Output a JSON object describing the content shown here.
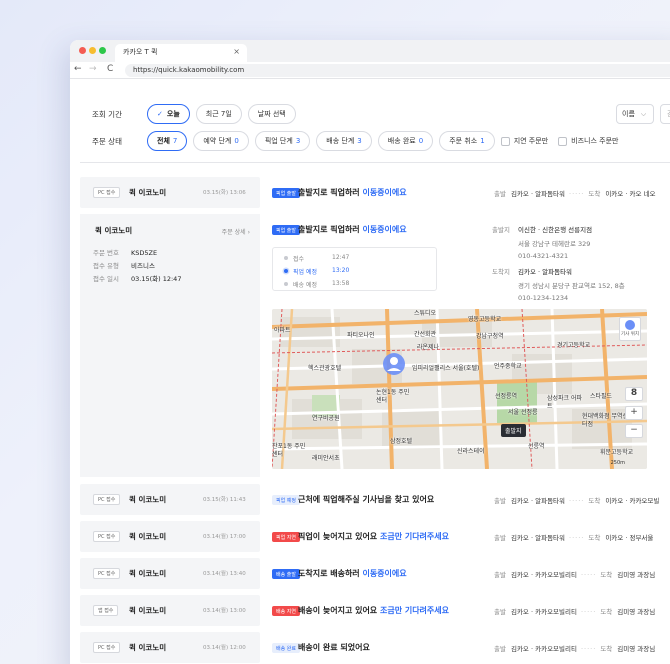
{
  "browser": {
    "tab_title": "카카오 T 퀵",
    "tab_close": "×",
    "url": "https://quick.kakaomobility.com",
    "back": "←",
    "forward": "→",
    "reload": "C"
  },
  "filters": {
    "period_label": "조회 기간",
    "period_options": [
      "오늘",
      "최근 7일",
      "날짜 선택"
    ],
    "period_check": "✓",
    "status_label": "주문 상태",
    "status_options": [
      {
        "label": "전체",
        "count": "7"
      },
      {
        "label": "예약 단계",
        "count": "0"
      },
      {
        "label": "픽업 단계",
        "count": "3"
      },
      {
        "label": "배송 단계",
        "count": "3"
      },
      {
        "label": "배송 완료",
        "count": "0"
      },
      {
        "label": "주문 취소",
        "count": "1"
      }
    ],
    "checkbox_delay": "지연 주문만",
    "checkbox_business": "비즈니스 주문만",
    "sort_value": "이름",
    "sort_caret": "⌵",
    "search_placeholder": "검색어를"
  },
  "labels": {
    "pickup": "출발",
    "dropoff": "도착",
    "dots": "·····",
    "detail": "주문 상세",
    "detail_arrow": "›"
  },
  "orders": [
    {
      "channel": "PC 접수",
      "service": "퀵 이코노미",
      "date": "03.15(화) 13:06",
      "badge": "픽업 출발",
      "msg_a": "출발지로 픽업하러 ",
      "msg_hl": "이동중이에요",
      "from": "김카오 · 알파돔타워",
      "to": "이카오 · 카오 네오"
    },
    {
      "channel": "PC 접수",
      "service": "퀵 이코노미",
      "date": "03.15(화) 11:43",
      "badge": "픽업 예정",
      "msg_a": "근처에 픽업해주실 기사님을 찾고 있어요",
      "msg_hl": "",
      "from": "김카오 · 알파돔타워",
      "to": "이카오 · 카카오모빌"
    },
    {
      "channel": "PC 접수",
      "service": "퀵 이코노미",
      "date": "03.14(월) 17:00",
      "badge": "픽업 지연",
      "msg_a": "픽업이 늦어지고 있어요 ",
      "msg_hl": "조금만 기다려주세요",
      "from": "김카오 · 알파돔타워",
      "to": "이카오 · 정부서울"
    },
    {
      "channel": "PC 접수",
      "service": "퀵 이코노미",
      "date": "03.14(월) 13:40",
      "badge": "배송 출발",
      "msg_a": "도착지로 배송하러 ",
      "msg_hl": "이동중이에요",
      "from": "김카오 · 카카오모빌리티",
      "to": "김미영 과장님"
    },
    {
      "channel": "앱 접수",
      "service": "퀵 이코노미",
      "date": "03.14(월) 13:00",
      "badge": "배송 지연",
      "msg_a": "배송이 늦어지고 있어요 ",
      "msg_hl": "조금만 기다려주세요",
      "from": "김카오 · 카카오모빌리티",
      "to": "김미영 과장님"
    },
    {
      "channel": "PC 접수",
      "service": "퀵 이코노미",
      "date": "03.14(월) 12:00",
      "badge": "배송 완료",
      "msg_a": "배송이 완료 되었어요",
      "msg_hl": "",
      "from": "김카오 · 카카오모빌리티",
      "to": "김미영 과장님"
    }
  ],
  "expanded": {
    "service": "퀵 이코노미",
    "badge": "픽업 출발",
    "msg_a": "출발지로 픽업하러 ",
    "msg_hl": "이동중이에요",
    "order_no_k": "주문 번호",
    "order_no_v": "KSD5ZE",
    "type_k": "접수 유형",
    "type_v": "비즈니스",
    "time_k": "접수 일시",
    "time_v": "03.15(화) 12:47",
    "timeline": [
      {
        "label": "접수",
        "time": "12:47"
      },
      {
        "label": "픽업 예정",
        "time": "13:20"
      },
      {
        "label": "배송 예정",
        "time": "13:58"
      }
    ],
    "sender_k": "출발지",
    "sender_v": "이신한 · 신한은행 선릉지점",
    "sender_addr": "서울 강남구 테헤란로 329",
    "sender_tel": "010-4321-4321",
    "recv_k": "도착지",
    "recv_v": "김카오 · 알파돔타워",
    "recv_addr": "경기 성남시 분당구 판교역로 152, 8층",
    "recv_tel": "010-1234-1234"
  },
  "map": {
    "labels": [
      "스튜디오",
      "아파트",
      "파티오나인",
      "라온제나",
      "간선회관",
      "영동고등학교",
      "강남구청역",
      "헥스관광호텔",
      "임피리얼팰리스 서울(호텔)",
      "언주중학교",
      "경기고등학교",
      "논현1동 주민센터",
      "연구비공원",
      "선정릉역",
      "삼성파크 어파트",
      "스타필드",
      "현대백화점 무역센터점",
      "서울 선정릉",
      "삼정호텔",
      "신라스테이",
      "선릉역",
      "휘문고등학교",
      "찬포1동 주민센터",
      "래미안서초"
    ],
    "driver": "기사 위치",
    "zoom": "8",
    "plus": "+",
    "minus": "−",
    "pin": "출발지",
    "scale": "250m"
  }
}
